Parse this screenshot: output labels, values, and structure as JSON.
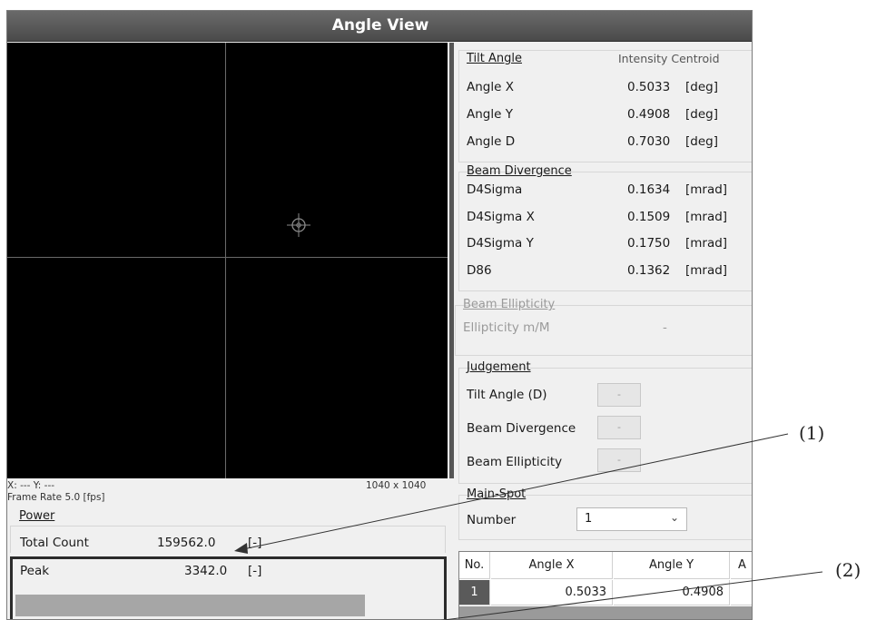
{
  "window": {
    "title": "Angle View"
  },
  "viewer": {
    "coord_text": "X: --- Y: ---",
    "resolution": "1040 x 1040",
    "frame_rate": "Frame Rate 5.0  [fps]"
  },
  "power": {
    "group_title": "Power",
    "total_count_label": "Total Count",
    "total_count_value": "159562.0",
    "total_count_unit": "[-]",
    "peak_label": "Peak",
    "peak_value": "3342.0",
    "peak_unit": "[-]",
    "peak_fill_fraction": 0.82
  },
  "tilt": {
    "group_title": "Tilt Angle",
    "method": "Intensity Centroid",
    "rows": [
      {
        "label": "Angle X",
        "value": "0.5033",
        "unit": "[deg]"
      },
      {
        "label": "Angle Y",
        "value": "0.4908",
        "unit": "[deg]"
      },
      {
        "label": "Angle D",
        "value": "0.7030",
        "unit": "[deg]"
      }
    ]
  },
  "divergence": {
    "group_title": "Beam Divergence",
    "rows": [
      {
        "label": "D4Sigma",
        "value": "0.1634",
        "unit": "[mrad]"
      },
      {
        "label": "D4Sigma X",
        "value": "0.1509",
        "unit": "[mrad]"
      },
      {
        "label": "D4Sigma Y",
        "value": "0.1750",
        "unit": "[mrad]"
      },
      {
        "label": "D86",
        "value": "0.1362",
        "unit": "[mrad]"
      }
    ]
  },
  "ellipticity": {
    "group_title": "Beam Ellipticity",
    "label": "Ellipticity m/M",
    "value": "-"
  },
  "judgement": {
    "group_title": "Judgement",
    "rows": [
      {
        "label": "Tilt Angle (D)",
        "result": "-"
      },
      {
        "label": "Beam Divergence",
        "result": "-"
      },
      {
        "label": "Beam Ellipticity",
        "result": "-"
      }
    ]
  },
  "main_spot": {
    "group_title": "Main-Spot",
    "number_label": "Number",
    "number_value": "1"
  },
  "spot_table": {
    "headers": [
      "No.",
      "Angle X",
      "Angle Y",
      "A"
    ],
    "rows": [
      {
        "no": "1",
        "angle_x": "0.5033",
        "angle_y": "0.4908"
      }
    ]
  },
  "callouts": [
    "(1)",
    "(2)"
  ],
  "icons": {
    "cursor": "crosshair-target-icon",
    "dropdown": "chevron-down-icon"
  }
}
